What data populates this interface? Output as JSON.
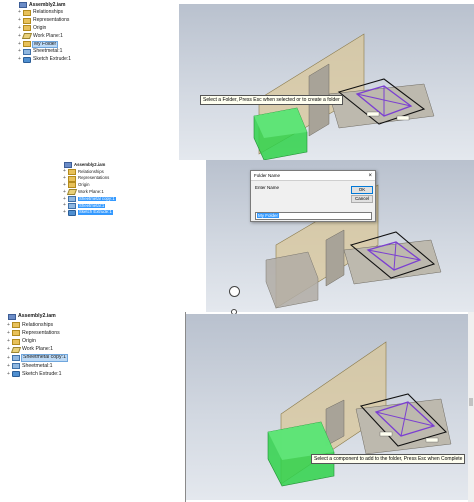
{
  "frame1": {
    "tree": [
      {
        "label": "Assembly2.iam",
        "icon": "assembly-icon",
        "bold": true
      },
      {
        "label": "Relationships",
        "icon": "folder-icon"
      },
      {
        "label": "Representations",
        "icon": "folder-icon"
      },
      {
        "label": "Origin",
        "icon": "folder-icon"
      },
      {
        "label": "Work Plane:1",
        "icon": "work-plane-icon"
      },
      {
        "label": "My Folder",
        "icon": "folder-icon",
        "state": "highlighted"
      },
      {
        "label": "Sheetmetal:1",
        "icon": "sheetmetal-icon"
      },
      {
        "label": "Sketch Extrude:1",
        "icon": "part-icon"
      }
    ],
    "tooltip": "Select a Folder, Press Esc when selected or to create a folder"
  },
  "frame2": {
    "tree": [
      {
        "label": "Assembly2.iam",
        "icon": "assembly-icon",
        "bold": true
      },
      {
        "label": "Relationships",
        "icon": "folder-icon"
      },
      {
        "label": "Representations",
        "icon": "folder-icon"
      },
      {
        "label": "Origin",
        "icon": "folder-icon"
      },
      {
        "label": "Work Plane:1",
        "icon": "work-plane-icon"
      },
      {
        "label": "Sheetmetal copy:1",
        "icon": "sheetmetal-icon",
        "state": "selected"
      },
      {
        "label": "Sheetmetal:1",
        "icon": "sheetmetal-icon",
        "state": "selected"
      },
      {
        "label": "Sketch Extrude:1",
        "icon": "part-icon",
        "state": "selected"
      }
    ],
    "dialog": {
      "title": "Folder Name",
      "close": "×",
      "prompt": "Enter Name",
      "ok": "OK",
      "cancel": "Cancel",
      "value": "My Folder"
    }
  },
  "frame3": {
    "tree": [
      {
        "label": "Assembly2.iam",
        "icon": "assembly-icon",
        "bold": true
      },
      {
        "label": "Relationships",
        "icon": "folder-icon"
      },
      {
        "label": "Representations",
        "icon": "folder-icon"
      },
      {
        "label": "Origin",
        "icon": "folder-icon"
      },
      {
        "label": "Work Plane:1",
        "icon": "work-plane-icon"
      },
      {
        "label": "Sheetmetal copy:1",
        "icon": "sheetmetal-icon",
        "state": "highlighted"
      },
      {
        "label": "Sheetmetal:1",
        "icon": "sheetmetal-icon"
      },
      {
        "label": "Sketch Extrude:1",
        "icon": "part-icon"
      }
    ],
    "tooltip": "Select a component to add to the folder, Press Esc when Complete"
  },
  "colors": {
    "viewport_top": "#b9c1ce",
    "green_block": "#2fd24a",
    "plane": "#d9c79a",
    "sheetmetal": "#7b3fd1",
    "selection": "#3399ff"
  }
}
